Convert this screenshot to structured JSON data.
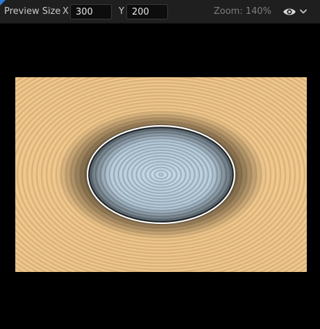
{
  "toolbar": {
    "preview_size_label": "Preview Size",
    "x_label": "X",
    "x_value": "300",
    "y_label": "Y",
    "y_value": "200",
    "zoom_label": "Zoom: 140%",
    "visibility_icon": "eye-icon",
    "dropdown_icon": "chevron-down-icon"
  },
  "colors": {
    "toolbar_bg": "#1f1f1f",
    "canvas_bg": "#000000",
    "outer_ring_light": "#f0c88e",
    "outer_ring_dark": "#c9a36c",
    "inner_ring_light": "#c4d8e6",
    "inner_ring_dark": "#7f95a6",
    "rim": "#ffffff",
    "accent": "#2f7bd8"
  }
}
